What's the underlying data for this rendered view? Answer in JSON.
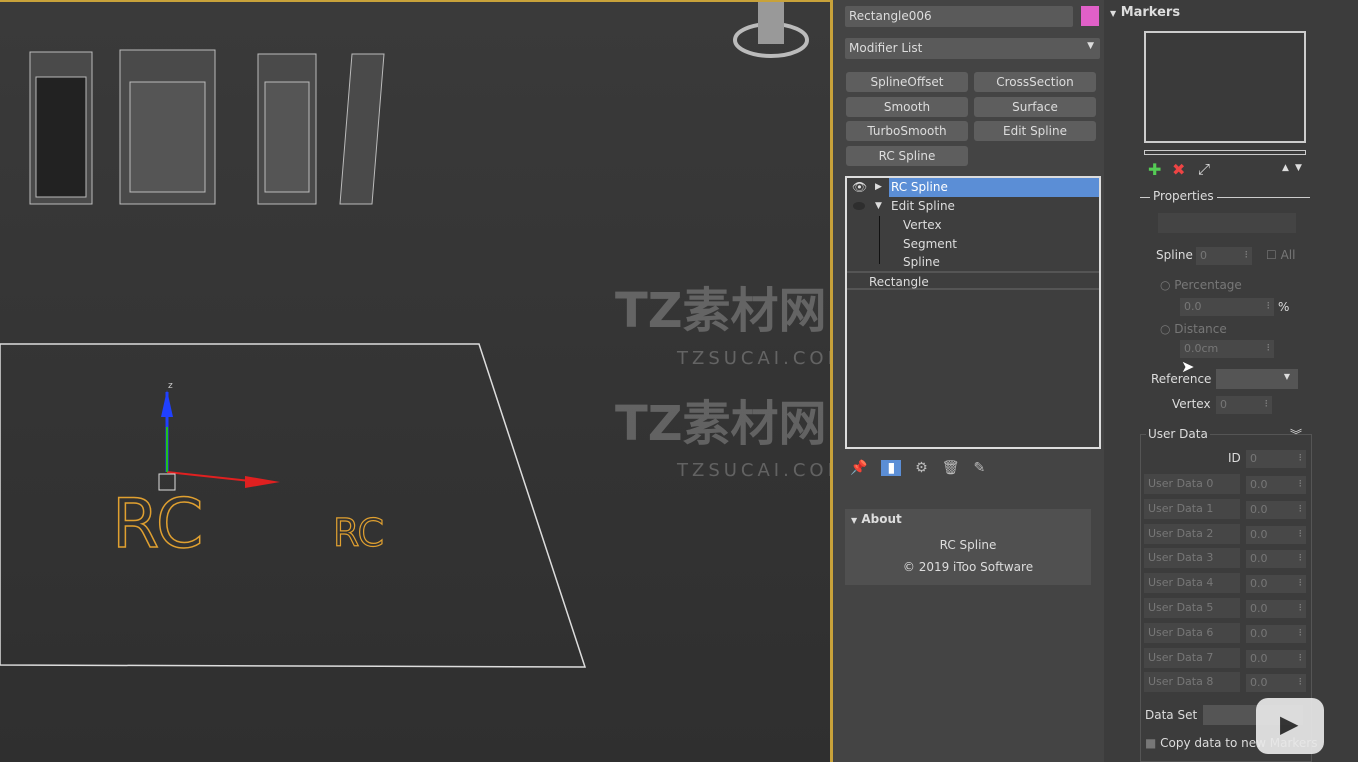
{
  "viewport": {
    "label_large": "RC",
    "label_small": "RC",
    "axis_z": "z",
    "watermark": {
      "brand": "TZ素材网",
      "url": "TZSUCAI.COM"
    }
  },
  "command_panel": {
    "object_name": "Rectangle006",
    "object_color": "#e060c8",
    "modifier_list": "Modifier List",
    "modifier_buttons": [
      "SplineOffset",
      "CrossSection",
      "Smooth",
      "Surface",
      "TurboSmooth",
      "Edit Spline",
      "RC Spline"
    ],
    "stack": [
      {
        "label": "RC Spline"
      },
      {
        "label": "Edit Spline"
      },
      {
        "label": "Vertex"
      },
      {
        "label": "Segment"
      },
      {
        "label": "Spline"
      },
      {
        "label": "Rectangle"
      }
    ],
    "about": {
      "title": "About",
      "name": "RC Spline",
      "copyright": "© 2019 iToo Software"
    }
  },
  "markers": {
    "title": "Markers",
    "properties": "Properties",
    "spline_label": "Spline",
    "spline_value": "0",
    "all_label": "All",
    "percentage_label": "Percentage",
    "percentage_value": "0.0",
    "percent_sign": "%",
    "distance_label": "Distance",
    "distance_value": "0.0cm",
    "reference_label": "Reference",
    "vertex_label": "Vertex",
    "vertex_value": "0",
    "user_data_title": "User Data",
    "id_label": "ID",
    "id_value": "0",
    "user_data": [
      {
        "name": "User Data 0",
        "value": "0.0"
      },
      {
        "name": "User Data 1",
        "value": "0.0"
      },
      {
        "name": "User Data 2",
        "value": "0.0"
      },
      {
        "name": "User Data 3",
        "value": "0.0"
      },
      {
        "name": "User Data 4",
        "value": "0.0"
      },
      {
        "name": "User Data 5",
        "value": "0.0"
      },
      {
        "name": "User Data 6",
        "value": "0.0"
      },
      {
        "name": "User Data 7",
        "value": "0.0"
      },
      {
        "name": "User Data 8",
        "value": "0.0"
      }
    ],
    "data_set_label": "Data Set",
    "copy_label": "Copy data to new Markers"
  }
}
